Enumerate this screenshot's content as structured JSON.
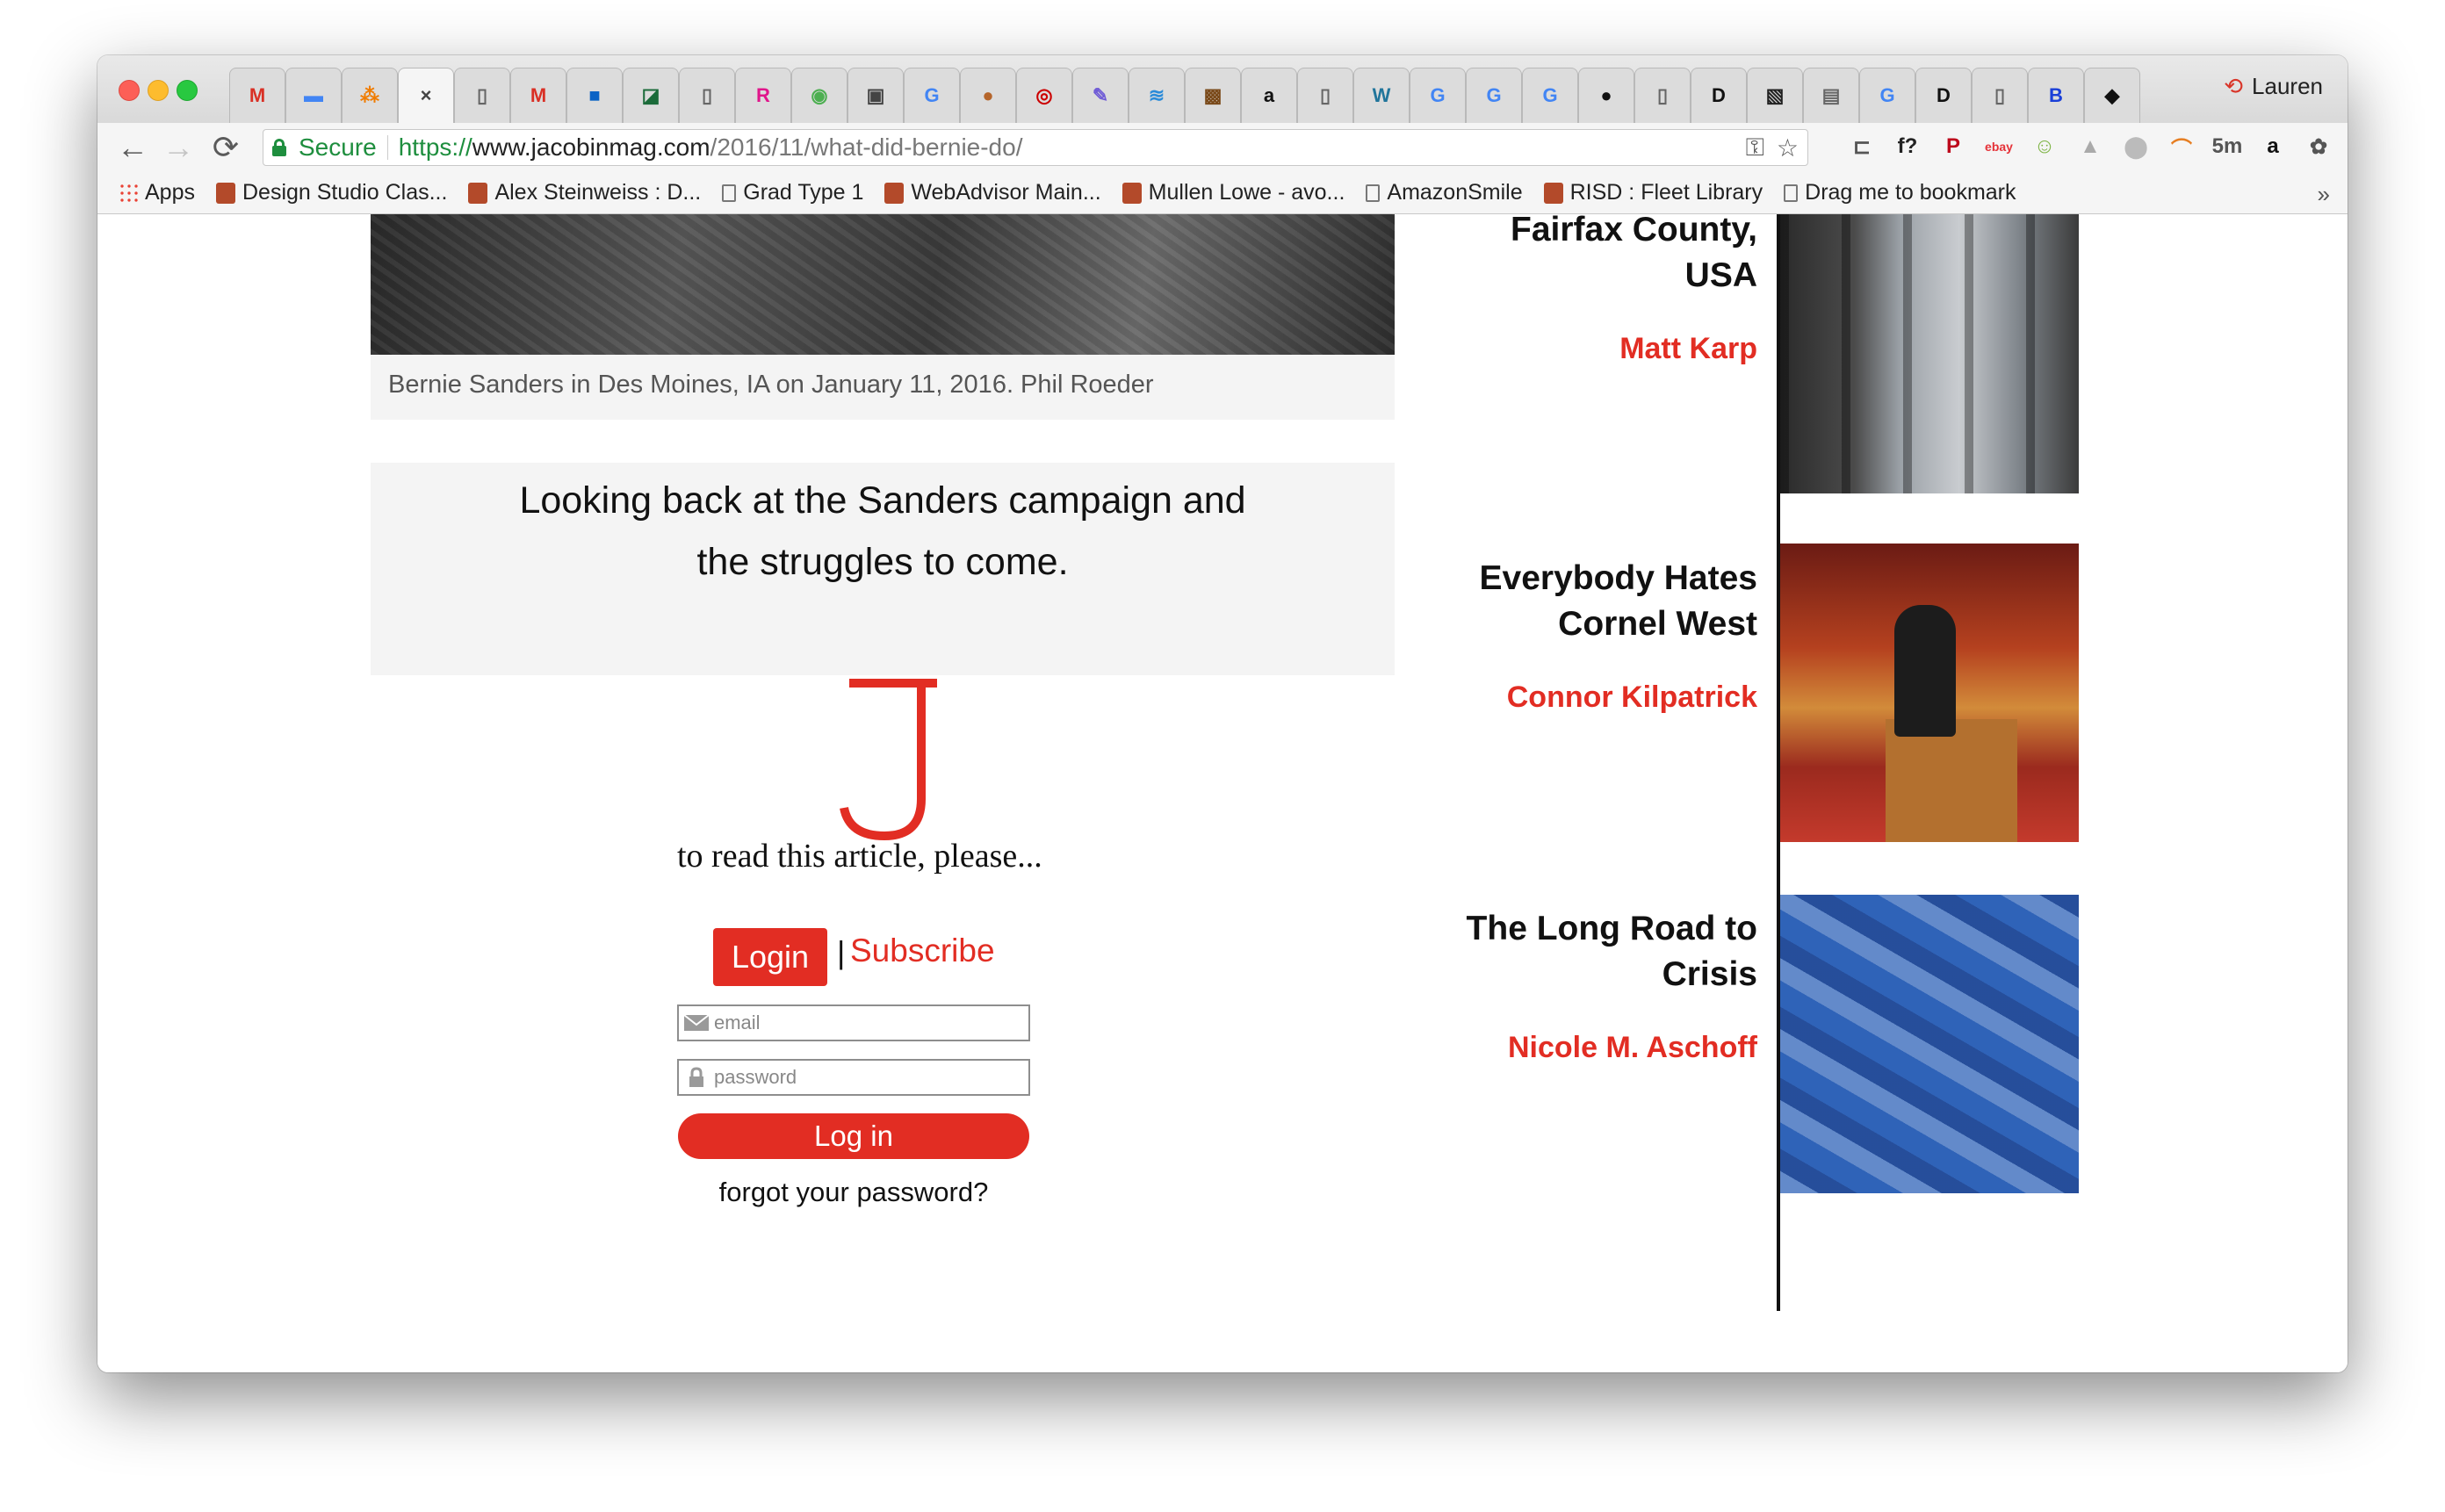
{
  "browser": {
    "tabs": [
      {
        "icon": "gmail-icon",
        "glyph": "M",
        "color": "#d93025"
      },
      {
        "icon": "google-docs-icon",
        "glyph": "▬",
        "color": "#4285f4"
      },
      {
        "icon": "orange-grid-icon",
        "glyph": "⁂",
        "color": "#f07c00"
      },
      {
        "icon": "active-tab",
        "glyph": "×",
        "color": "#444"
      },
      {
        "icon": "page-icon",
        "glyph": "▯",
        "color": "#666"
      },
      {
        "icon": "gmail-100-icon",
        "glyph": "M",
        "color": "#d93025"
      },
      {
        "icon": "blue-square-icon",
        "glyph": "■",
        "color": "#0b63c5"
      },
      {
        "icon": "green-c-icon",
        "glyph": "◪",
        "color": "#1b6b3a"
      },
      {
        "icon": "page-icon",
        "glyph": "▯",
        "color": "#666"
      },
      {
        "icon": "risd-icon",
        "glyph": "R",
        "color": "#e0168b"
      },
      {
        "icon": "chat-icon",
        "glyph": "◉",
        "color": "#4caf50"
      },
      {
        "icon": "bag-icon",
        "glyph": "▣",
        "color": "#444"
      },
      {
        "icon": "google-icon",
        "glyph": "G",
        "color": "#4285f4"
      },
      {
        "icon": "globe-icon",
        "glyph": "●",
        "color": "#b5652b"
      },
      {
        "icon": "target-icon",
        "glyph": "◎",
        "color": "#cc0000"
      },
      {
        "icon": "feather-icon",
        "glyph": "✎",
        "color": "#6f5bd6"
      },
      {
        "icon": "waves-icon",
        "glyph": "≋",
        "color": "#2a8bd9"
      },
      {
        "icon": "picture-icon",
        "glyph": "▩",
        "color": "#7a4a1a"
      },
      {
        "icon": "amazon-icon",
        "glyph": "a",
        "color": "#111"
      },
      {
        "icon": "page-icon",
        "glyph": "▯",
        "color": "#666"
      },
      {
        "icon": "wordpress-icon",
        "glyph": "W",
        "color": "#21759b"
      },
      {
        "icon": "google-icon",
        "glyph": "G",
        "color": "#4285f4"
      },
      {
        "icon": "google-icon",
        "glyph": "G",
        "color": "#4285f4"
      },
      {
        "icon": "google-icon",
        "glyph": "G",
        "color": "#4285f4"
      },
      {
        "icon": "github-icon",
        "glyph": "●",
        "color": "#111"
      },
      {
        "icon": "page-icon",
        "glyph": "▯",
        "color": "#666"
      },
      {
        "icon": "black-d-icon",
        "glyph": "D",
        "color": "#111"
      },
      {
        "icon": "stripes-icon",
        "glyph": "▧",
        "color": "#222"
      },
      {
        "icon": "doc-thumb-icon",
        "glyph": "▤",
        "color": "#666"
      },
      {
        "icon": "google-icon",
        "glyph": "G",
        "color": "#4285f4"
      },
      {
        "icon": "black-d-icon",
        "glyph": "D",
        "color": "#111"
      },
      {
        "icon": "page-icon",
        "glyph": "▯",
        "color": "#666"
      },
      {
        "icon": "b-icon",
        "glyph": "B",
        "color": "#1a3fd8"
      },
      {
        "icon": "fox-icon",
        "glyph": "◆",
        "color": "#111"
      }
    ],
    "profile_name": "Lauren",
    "back_label": "←",
    "forward_label": "→",
    "reload_label": "⟳",
    "secure_label": "Secure",
    "url_scheme": "https://",
    "url_host": "www.jacobinmag.com",
    "url_path": "/2016/11/what-did-bernie-do/",
    "key_icon": "⚿",
    "star_icon": "☆",
    "extensions": [
      {
        "name": "cast-icon",
        "glyph": "⊏",
        "color": "#555"
      },
      {
        "name": "font-icon",
        "glyph": "f?",
        "color": "#222"
      },
      {
        "name": "pinterest-icon",
        "glyph": "P",
        "color": "#bd081c"
      },
      {
        "name": "ebay-icon",
        "glyph": "ebay",
        "color": "#e53238"
      },
      {
        "name": "smiley-icon",
        "glyph": "☺",
        "color": "#7cb342"
      },
      {
        "name": "triangle-icon",
        "glyph": "▲",
        "color": "#aaa"
      },
      {
        "name": "drop-icon",
        "glyph": "⬤",
        "color": "#bbb"
      },
      {
        "name": "rainbow-icon",
        "glyph": "⌒",
        "color": "#e67e22"
      },
      {
        "name": "timer-5m-icon",
        "glyph": "5m",
        "color": "#555"
      },
      {
        "name": "amazon-assistant-icon",
        "glyph": "a",
        "color": "#111"
      },
      {
        "name": "evernote-icon",
        "glyph": "✿",
        "color": "#555"
      },
      {
        "name": "menu-icon",
        "glyph": "⋮",
        "color": "#555"
      }
    ],
    "bookmarks": [
      {
        "icon": "apps-icon",
        "label": "Apps"
      },
      {
        "icon": "table-icon",
        "label": "Design Studio Clas..."
      },
      {
        "icon": "h-icon",
        "label": "Alex Steinweiss : D..."
      },
      {
        "icon": "page-icon",
        "label": "Grad Type 1"
      },
      {
        "icon": "webadvisor-icon",
        "label": "WebAdvisor Main..."
      },
      {
        "icon": "mullen-icon",
        "label": "Mullen Lowe - avo..."
      },
      {
        "icon": "page-icon",
        "label": "AmazonSmile"
      },
      {
        "icon": "risd-fleet-icon",
        "label": "RISD : Fleet Library"
      },
      {
        "icon": "page-icon",
        "label": "Drag me to bookmark"
      }
    ],
    "bookmarks_more": "»"
  },
  "article": {
    "caption": "Bernie Sanders in Des Moines, IA on January 11, 2016. Phil Roeder",
    "dek_line1": "Looking back at the Sanders campaign and",
    "dek_line2": "the struggles to come.",
    "gate_text": "to read this article, please...",
    "login_tab": "Login",
    "separator": "|",
    "subscribe": "Subscribe",
    "email_placeholder": "email",
    "password_placeholder": "password",
    "login_button": "Log in",
    "forgot": "forgot your password?",
    "brand_color": "#e22d23"
  },
  "sidebar": {
    "articles": [
      {
        "title_line1": "Fairfax County,",
        "title_line2": "USA",
        "author": "Matt Karp"
      },
      {
        "title_line1": "Everybody Hates",
        "title_line2": "Cornel West",
        "author": "Connor Kilpatrick"
      },
      {
        "title_line1": "The Long Road to",
        "title_line2": "Crisis",
        "author": "Nicole M. Aschoff"
      }
    ]
  }
}
